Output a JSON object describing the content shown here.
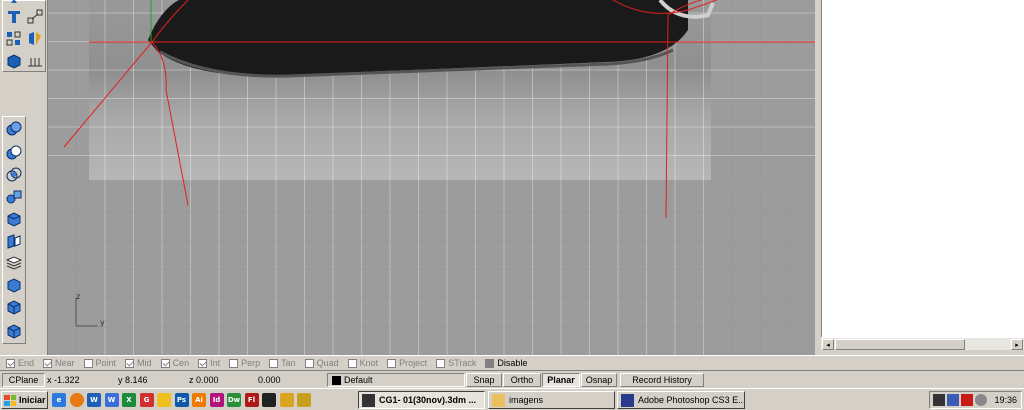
{
  "osnap": [
    {
      "label": "End",
      "checked": true,
      "active": false
    },
    {
      "label": "Near",
      "checked": true,
      "active": false
    },
    {
      "label": "Point",
      "checked": false,
      "active": false
    },
    {
      "label": "Mid",
      "checked": true,
      "active": false
    },
    {
      "label": "Cen",
      "checked": true,
      "active": false
    },
    {
      "label": "Int",
      "checked": true,
      "active": false
    },
    {
      "label": "Perp",
      "checked": false,
      "active": false
    },
    {
      "label": "Tan",
      "checked": false,
      "active": false
    },
    {
      "label": "Quad",
      "checked": false,
      "active": false
    },
    {
      "label": "Knot",
      "checked": false,
      "active": false
    },
    {
      "label": "Project",
      "checked": false,
      "active": false
    },
    {
      "label": "STrack",
      "checked": false,
      "active": false
    },
    {
      "label": "Disable",
      "checked": false,
      "active": true
    }
  ],
  "status": {
    "cplane": "CPlane",
    "x": "x -1.322",
    "y": "y 8.146",
    "z": "z 0.000",
    "extra": "0.000",
    "layer": "Default",
    "snap": "Snap",
    "ortho": "Ortho",
    "planar": "Planar",
    "osnap": "Osnap",
    "record_history": "Record History"
  },
  "viewport": {
    "axis_z": "z",
    "axis_y": "y"
  },
  "taskbar": {
    "start": "Iniciar",
    "quicklaunch": [
      "ie-icon",
      "firefox-icon",
      "word-icon",
      "write-icon",
      "excel-icon",
      "photo-icon",
      "explorer-icon",
      "ps-icon",
      "ai-icon",
      "id-icon",
      "dw-icon",
      "fl-icon",
      "rhino-icon",
      "folder-icon",
      "media-icon"
    ],
    "tasks": [
      {
        "label": "CG1- 01(30nov).3dm ...",
        "pressed": true
      },
      {
        "label": "imagens",
        "pressed": false
      },
      {
        "label": "Adobe Photoshop CS3 E...",
        "pressed": false
      }
    ],
    "clock": "19:36"
  },
  "colors": {
    "accent_red": "#e02020",
    "viewport_bg": "#9c9c9c",
    "chrome": "#d4d0c8"
  }
}
